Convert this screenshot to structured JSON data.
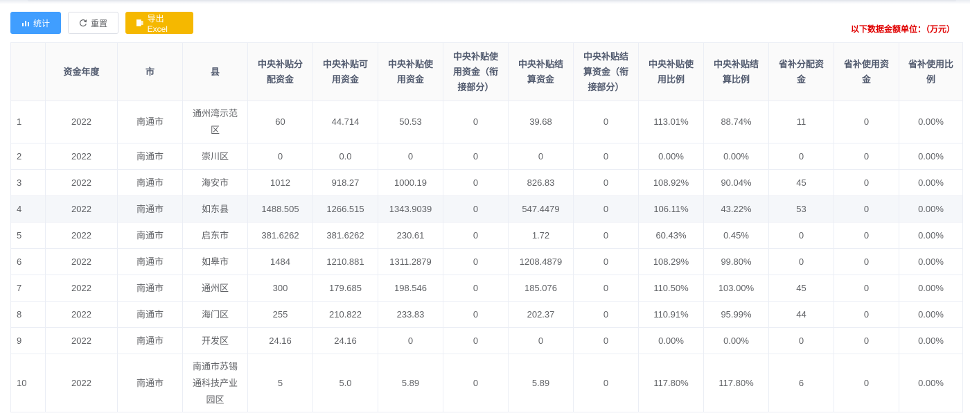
{
  "toolbar": {
    "stats_label": "统计",
    "reset_label": "重置",
    "export_label": "导出Excel"
  },
  "unit_note": "以下数据金额单位：（万元）",
  "table": {
    "headers": [
      "",
      "资金年度",
      "市",
      "县",
      "中央补贴分配资金",
      "中央补贴可用资金",
      "中央补贴使用资金",
      "中央补贴使用资金（衔接部分）",
      "中央补贴结算资金",
      "中央补贴结算资金（衔接部分）",
      "中央补贴使用比例",
      "中央补贴结算比例",
      "省补分配资金",
      "省补使用资金",
      "省补使用比例"
    ],
    "rows": [
      [
        "1",
        "2022",
        "南通市",
        "通州湾示范区",
        "60",
        "44.714",
        "50.53",
        "0",
        "39.68",
        "0",
        "113.01%",
        "88.74%",
        "11",
        "0",
        "0.00%"
      ],
      [
        "2",
        "2022",
        "南通市",
        "崇川区",
        "0",
        "0.0",
        "0",
        "0",
        "0",
        "0",
        "0.00%",
        "0.00%",
        "0",
        "0",
        "0.00%"
      ],
      [
        "3",
        "2022",
        "南通市",
        "海安市",
        "1012",
        "918.27",
        "1000.19",
        "0",
        "826.83",
        "0",
        "108.92%",
        "90.04%",
        "45",
        "0",
        "0.00%"
      ],
      [
        "4",
        "2022",
        "南通市",
        "如东县",
        "1488.505",
        "1266.515",
        "1343.9039",
        "0",
        "547.4479",
        "0",
        "106.11%",
        "43.22%",
        "53",
        "0",
        "0.00%"
      ],
      [
        "5",
        "2022",
        "南通市",
        "启东市",
        "381.6262",
        "381.6262",
        "230.61",
        "0",
        "1.72",
        "0",
        "60.43%",
        "0.45%",
        "0",
        "0",
        "0.00%"
      ],
      [
        "6",
        "2022",
        "南通市",
        "如皋市",
        "1484",
        "1210.881",
        "1311.2879",
        "0",
        "1208.4879",
        "0",
        "108.29%",
        "99.80%",
        "0",
        "0",
        "0.00%"
      ],
      [
        "7",
        "2022",
        "南通市",
        "通州区",
        "300",
        "179.685",
        "198.546",
        "0",
        "185.076",
        "0",
        "110.50%",
        "103.00%",
        "45",
        "0",
        "0.00%"
      ],
      [
        "8",
        "2022",
        "南通市",
        "海门区",
        "255",
        "210.822",
        "233.83",
        "0",
        "202.37",
        "0",
        "110.91%",
        "95.99%",
        "44",
        "0",
        "0.00%"
      ],
      [
        "9",
        "2022",
        "南通市",
        "开发区",
        "24.16",
        "24.16",
        "0",
        "0",
        "0",
        "0",
        "0.00%",
        "0.00%",
        "0",
        "0",
        "0.00%"
      ],
      [
        "10",
        "2022",
        "南通市",
        "南通市苏锡通科技产业园区",
        "5",
        "5.0",
        "5.89",
        "0",
        "5.89",
        "0",
        "117.80%",
        "117.80%",
        "6",
        "0",
        "0.00%"
      ]
    ]
  },
  "colors": {
    "primary": "#409eff",
    "warning": "#f5b800",
    "unit_note": "#e00000",
    "highlight_row": "#f5f7fa"
  },
  "icons": {
    "stats": "bar-chart-icon",
    "reset": "refresh-icon",
    "export": "excel-file-icon"
  }
}
